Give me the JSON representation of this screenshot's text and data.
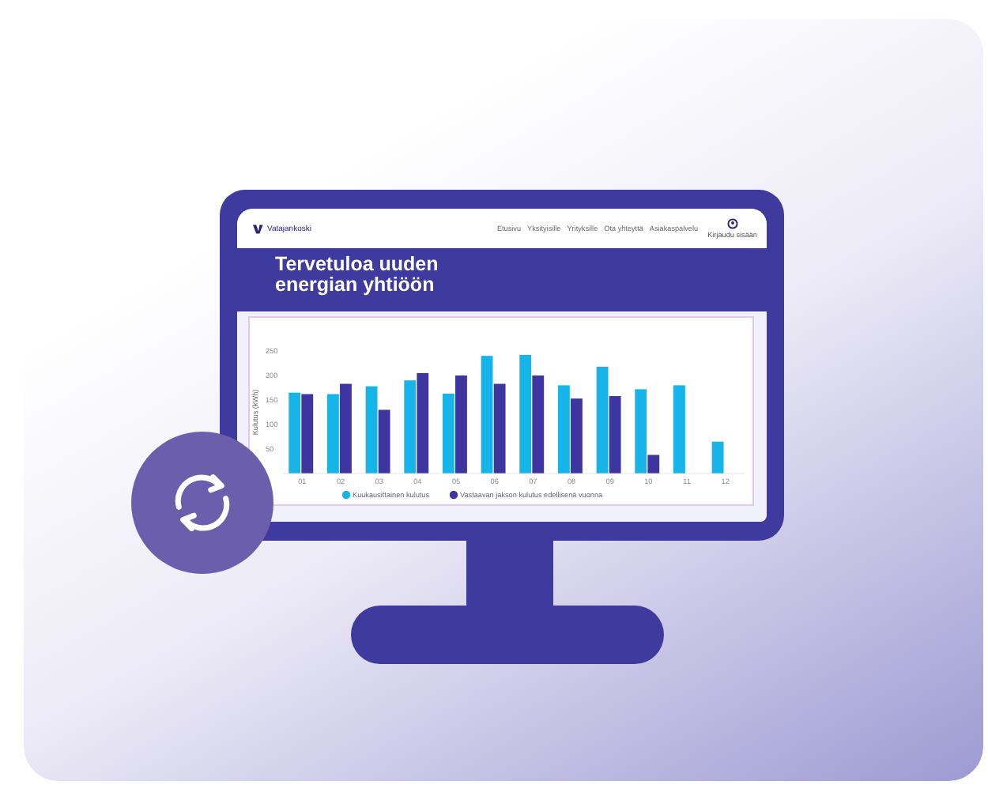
{
  "site": {
    "logo": "Vatajankoski",
    "nav": [
      {
        "label": "Etusivu"
      },
      {
        "label": "Yksityisille"
      },
      {
        "label": "Yrityksille"
      },
      {
        "label": "Ota yhteyttä"
      },
      {
        "label": "Asiakaspalvelu"
      }
    ],
    "account": "Kirjaudu sisään"
  },
  "hero": {
    "title": "Tervetuloa uuden energian yhtiöön"
  },
  "chart_data": {
    "type": "bar",
    "ylabel": "Kulutus (kWh)",
    "categories": [
      "01",
      "02",
      "03",
      "04",
      "05",
      "06",
      "07",
      "08",
      "09",
      "10",
      "11",
      "12"
    ],
    "ylim": [
      0,
      250
    ],
    "legend": true,
    "yticks": [
      50,
      100,
      150,
      200,
      250
    ],
    "series": [
      {
        "name": "Kuukausittainen kulutus",
        "color": "#16b4e8",
        "values": [
          165,
          162,
          178,
          190,
          163,
          240,
          242,
          180,
          218,
          172,
          180,
          65
        ]
      },
      {
        "name": "Vastaavan jakson kulutus edellisenä vuonna",
        "color": "#3f35a0",
        "values": [
          162,
          183,
          130,
          205,
          200,
          183,
          200,
          153,
          158,
          38,
          null,
          null
        ]
      }
    ]
  }
}
